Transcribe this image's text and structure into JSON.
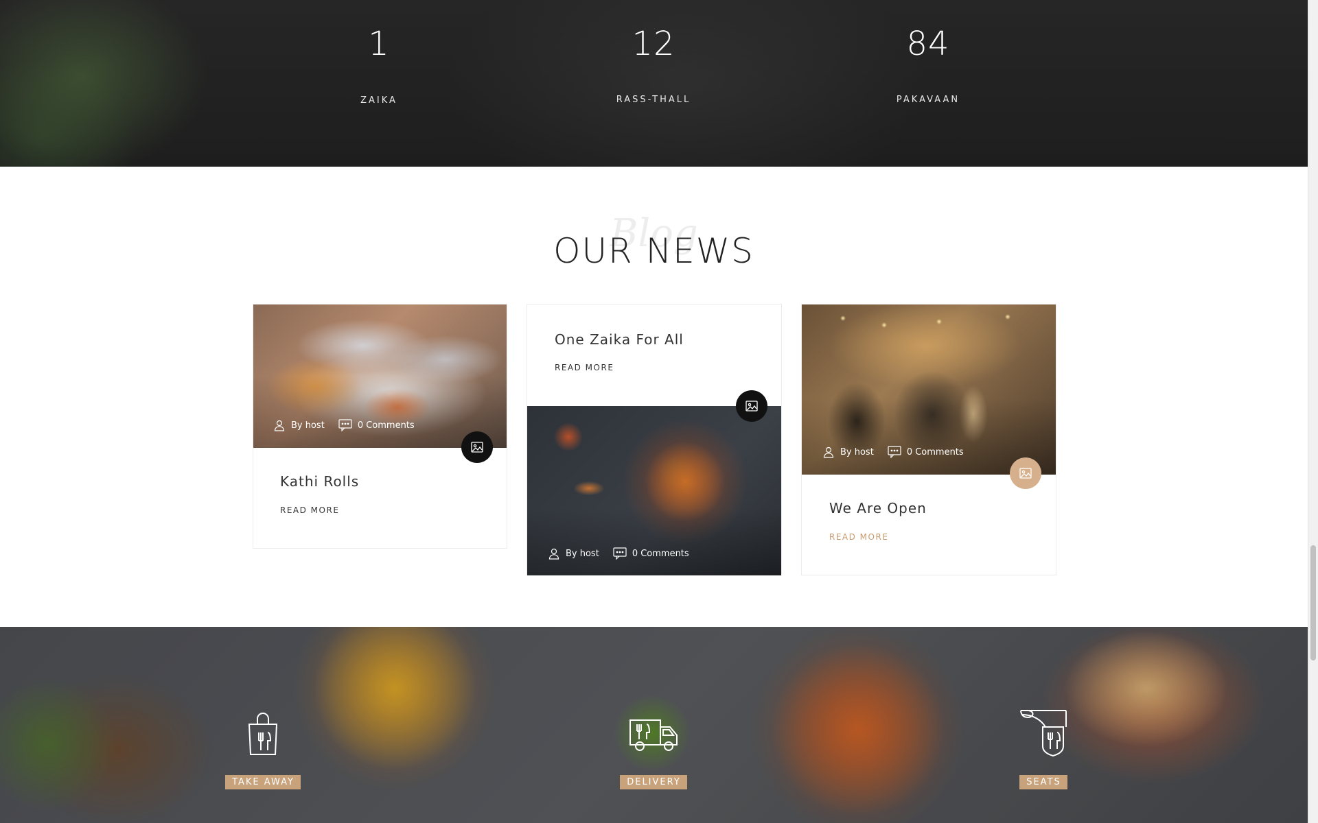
{
  "counters": [
    {
      "number": "1",
      "label": "ZAIKA"
    },
    {
      "number": "12",
      "label": "RASS-THALL"
    },
    {
      "number": "84",
      "label": "PAKAVAAN"
    }
  ],
  "news": {
    "script_word": "Blog",
    "title": "OUR NEWS",
    "posts": [
      {
        "title": "Kathi Rolls",
        "author": "By host",
        "comments": "0 Comments",
        "read_more": "READ MORE",
        "format_icon": "image-icon"
      },
      {
        "title": "One Zaika For All",
        "author": "By host",
        "comments": "0 Comments",
        "read_more": "READ MORE",
        "format_icon": "image-icon"
      },
      {
        "title": "We Are Open",
        "author": "By host",
        "comments": "0 Comments",
        "read_more": "READ MORE",
        "format_icon": "image-icon",
        "accent": "#c79a6e"
      }
    ]
  },
  "services": [
    {
      "label": "TAKE AWAY",
      "icon": "takeaway-bag-icon"
    },
    {
      "label": "DELIVERY",
      "icon": "delivery-truck-icon"
    },
    {
      "label": "SEATS",
      "icon": "restaurant-sign-icon"
    }
  ],
  "colors": {
    "accent": "#c8a27a",
    "dark": "#111111"
  }
}
